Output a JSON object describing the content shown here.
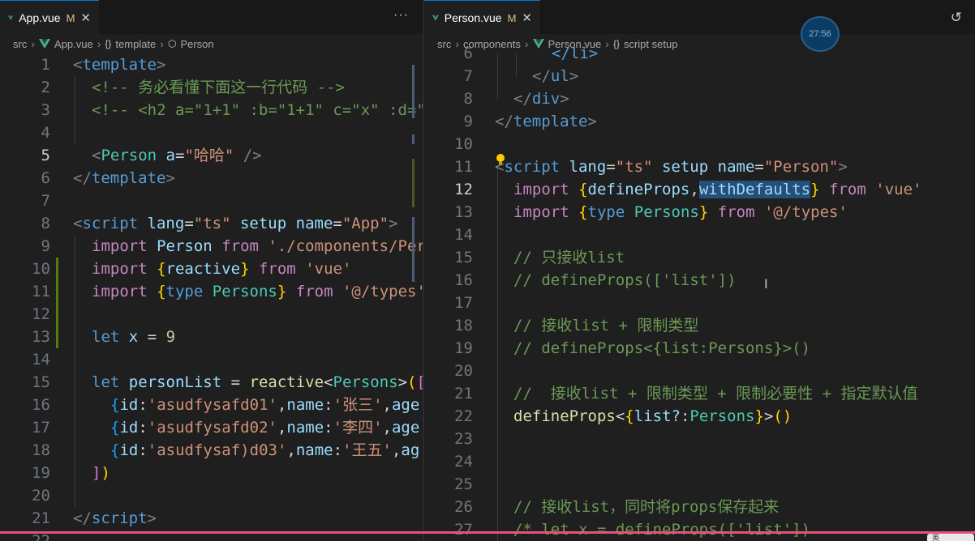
{
  "left_editor": {
    "tab": {
      "label": "App.vue",
      "modified": "M",
      "icon": "vue-icon"
    },
    "breadcrumb": [
      "src",
      "App.vue",
      "template",
      "Person"
    ],
    "lines": [
      {
        "n": "1"
      },
      {
        "n": "2"
      },
      {
        "n": "3"
      },
      {
        "n": "4"
      },
      {
        "n": "5"
      },
      {
        "n": "6"
      },
      {
        "n": "7"
      },
      {
        "n": "8"
      },
      {
        "n": "9"
      },
      {
        "n": "10"
      },
      {
        "n": "11"
      },
      {
        "n": "12"
      },
      {
        "n": "13"
      },
      {
        "n": "14"
      },
      {
        "n": "15"
      },
      {
        "n": "16"
      },
      {
        "n": "17"
      },
      {
        "n": "18"
      },
      {
        "n": "19"
      },
      {
        "n": "20"
      },
      {
        "n": "21"
      },
      {
        "n": "22"
      }
    ],
    "code": {
      "l1_tag": "template",
      "l2_comment": "<!-- 务必看懂下面这一行代码 -->",
      "l3_comment": "<!-- <h2 a=\"1+1\" :b=\"1+1\" c=\"x\" :d=\"",
      "l5_tag": "Person",
      "l5_attr": "a",
      "l5_val": "\"哈哈\"",
      "l6_tag": "template",
      "l8_tag": "script",
      "l8_lang_attr": "lang",
      "l8_lang_val": "\"ts\"",
      "l8_setup": "setup",
      "l8_name_attr": "name",
      "l8_name_val": "\"App\"",
      "l9_ident": "Person",
      "l9_path": "'./components/Per",
      "l10_ident": "reactive",
      "l10_path": "'vue'",
      "l11_type_kw": "type",
      "l11_ident": "Persons",
      "l11_path": "'@/types'",
      "l13_kw": "let",
      "l13_var": "x",
      "l13_num": "9",
      "l15_kw": "let",
      "l15_var": "personList",
      "l15_fn": "reactive",
      "l15_type": "Persons",
      "l16_id": "'asudfysafd01'",
      "l16_name": "'张三'",
      "l16_rest": "age",
      "l17_id": "'asudfysafd02'",
      "l17_name": "'李四'",
      "l17_rest": "age",
      "l18_id": "'asudfysaf)d03'",
      "l18_name": "'王五'",
      "l18_rest": "ag",
      "l21_tag": "script"
    }
  },
  "right_editor": {
    "tab": {
      "label": "Person.vue",
      "modified": "M",
      "icon": "vue-icon"
    },
    "breadcrumb": [
      "src",
      "components",
      "Person.vue",
      "script setup"
    ],
    "timer": "27:56",
    "lines": [
      {
        "n": "6"
      },
      {
        "n": "7"
      },
      {
        "n": "8"
      },
      {
        "n": "9"
      },
      {
        "n": "10"
      },
      {
        "n": "11"
      },
      {
        "n": "12"
      },
      {
        "n": "13"
      },
      {
        "n": "14"
      },
      {
        "n": "15"
      },
      {
        "n": "16"
      },
      {
        "n": "17"
      },
      {
        "n": "18"
      },
      {
        "n": "19"
      },
      {
        "n": "20"
      },
      {
        "n": "21"
      },
      {
        "n": "22"
      },
      {
        "n": "23"
      },
      {
        "n": "24"
      },
      {
        "n": "25"
      },
      {
        "n": "26"
      },
      {
        "n": "27"
      }
    ],
    "code": {
      "l6": "</li>",
      "l7_tag": "ul",
      "l8_tag": "div",
      "l9_tag": "template",
      "l11_tag": "script",
      "l11_lang_attr": "lang",
      "l11_lang_val": "\"ts\"",
      "l11_setup": "setup",
      "l11_name_attr": "name",
      "l11_name_val": "\"Person\"",
      "l12_a": "defineProps",
      "l12_b": "withDefaults",
      "l12_path": "'vue'",
      "l13_type_kw": "type",
      "l13_ident": "Persons",
      "l13_path": "'@/types'",
      "l15": "// 只接收list",
      "l16": "// defineProps(['list'])",
      "l18": "// 接收list + 限制类型",
      "l19": "// defineProps<{list:Persons}>()",
      "l21": "//  接收list + 限制类型 + 限制必要性 + 指定默认值",
      "l22_fn": "defineProps",
      "l22_prop": "list?",
      "l22_type": "Persons",
      "l26": "// 接收list，同时将props保存起来",
      "l27": "/* let x = defineProps(['list'])"
    }
  },
  "common": {
    "kw_import": "import",
    "kw_from": "from",
    "kw_const_id": "id",
    "kw_const_name": "name",
    "ime_label": "英"
  },
  "colors": {
    "editor_bg": "#1f1f1f",
    "tabbar_bg": "#181818",
    "accent_bottom": "#e8507a",
    "modified_gutter": "#2b5d91",
    "added_gutter": "#587c0c"
  }
}
